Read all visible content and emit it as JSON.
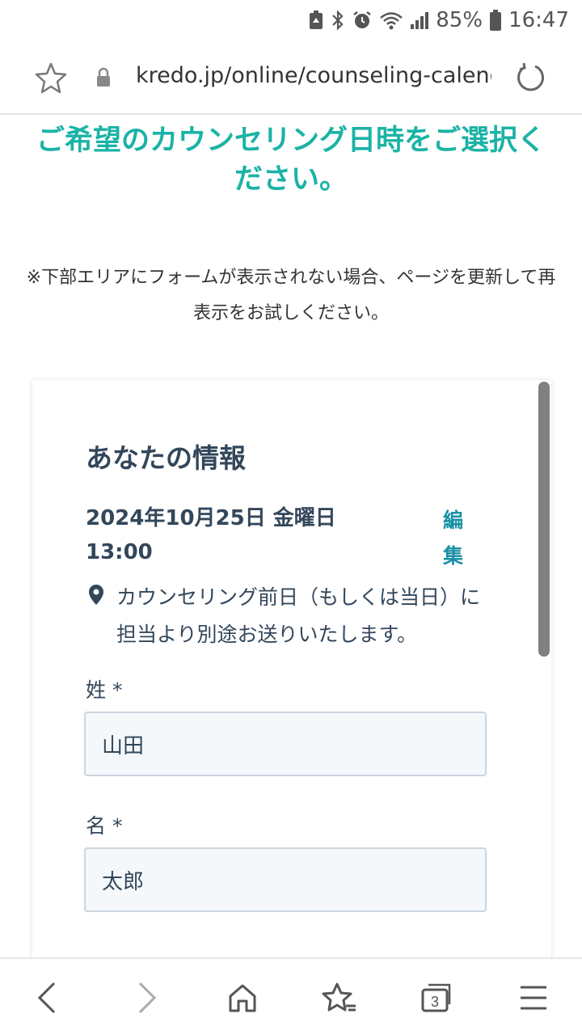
{
  "status_bar": {
    "battery": "85%",
    "time": "16:47"
  },
  "browser": {
    "url": "kredo.jp/online/counseling-calendar",
    "tab_count": "3"
  },
  "page": {
    "title": "ご希望のカウンセリング日時をご選択ください。",
    "notice": "※下部エリアにフォームが表示されない場合、ページを更新して再表示をお試しください。"
  },
  "card": {
    "heading": "あなたの情報",
    "datetime": "2024年10月25日 金曜日 13:00",
    "edit_label": "編集",
    "location_text": "カウンセリング前日（もしくは当日）に担当より別途お送りいたします。",
    "fields": {
      "last_name_label": "姓 *",
      "last_name_value": "山田",
      "first_name_label": "名 *",
      "first_name_value": "太郎"
    }
  },
  "icons": {
    "bookmark": "star-icon",
    "secure": "lock-icon",
    "reload": "reload-icon",
    "location": "pin-icon"
  },
  "colors": {
    "accent_teal": "#1bb3a6",
    "link": "#1a90a6",
    "text_dark": "#33475b",
    "input_bg": "#f5f8fa",
    "input_border": "#cbd6e2"
  }
}
